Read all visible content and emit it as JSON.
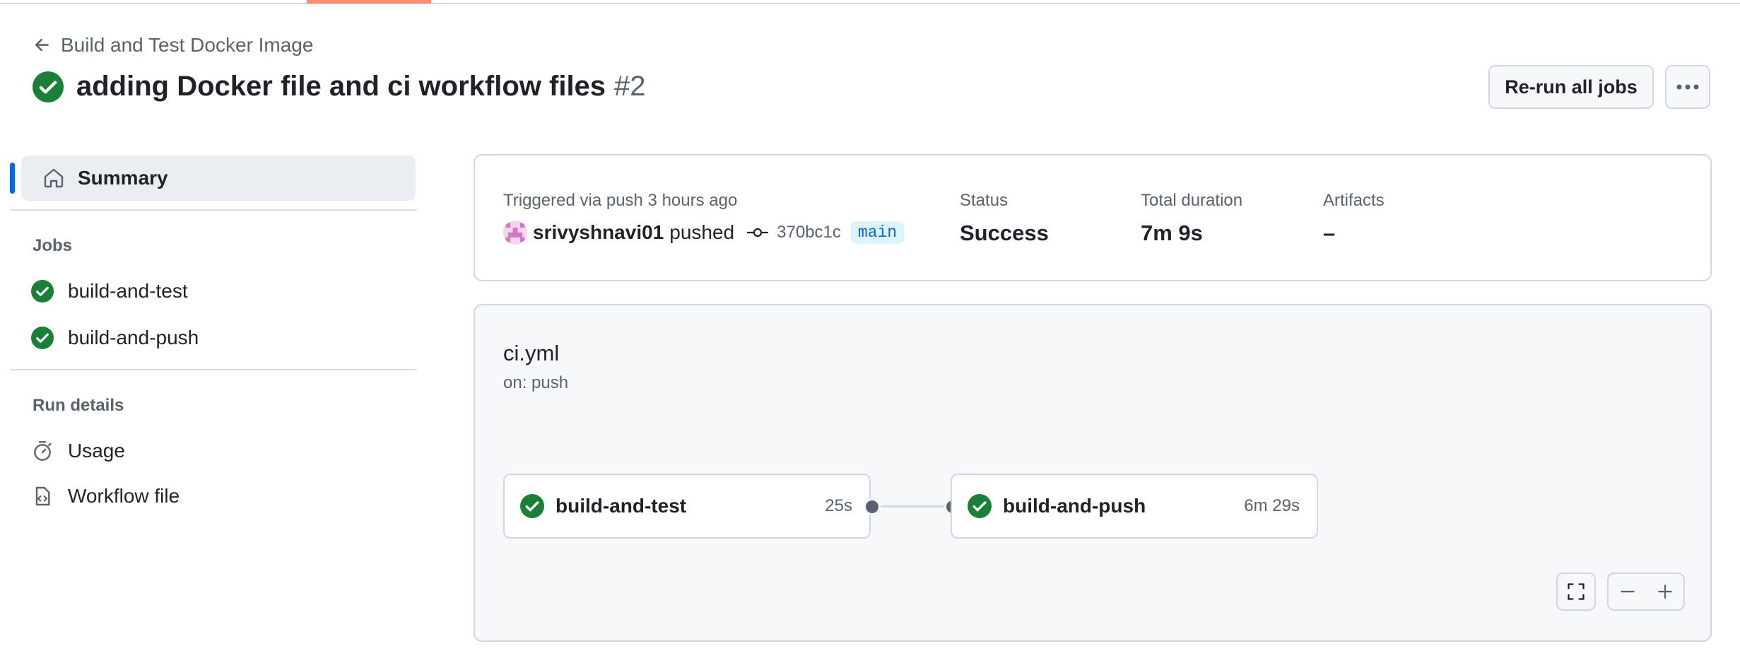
{
  "header": {
    "back_label": "Build and Test Docker Image",
    "run_title": "adding Docker file and ci workflow files",
    "run_number": "#2",
    "rerun_label": "Re-run all jobs"
  },
  "sidebar": {
    "summary_label": "Summary",
    "jobs_heading": "Jobs",
    "jobs": [
      {
        "label": "build-and-test"
      },
      {
        "label": "build-and-push"
      }
    ],
    "run_details_heading": "Run details",
    "run_details": [
      {
        "label": "Usage",
        "icon": "stopwatch-icon"
      },
      {
        "label": "Workflow file",
        "icon": "file-code-icon"
      }
    ]
  },
  "summary": {
    "trigger_label": "Triggered via push 3 hours ago",
    "user": "srivyshnavi01",
    "action": "pushed",
    "commit": "370bc1c",
    "branch": "main",
    "status_label": "Status",
    "status_value": "Success",
    "duration_label": "Total duration",
    "duration_value": "7m 9s",
    "artifacts_label": "Artifacts",
    "artifacts_value": "–"
  },
  "graph": {
    "workflow_name": "ci.yml",
    "trigger": "on: push",
    "jobs": [
      {
        "label": "build-and-test",
        "duration": "25s"
      },
      {
        "label": "build-and-push",
        "duration": "6m 29s"
      }
    ]
  },
  "colors": {
    "success": "#1a7f37",
    "accent": "#0969da",
    "tab_underline": "#fd8c73",
    "muted": "#59636e"
  }
}
